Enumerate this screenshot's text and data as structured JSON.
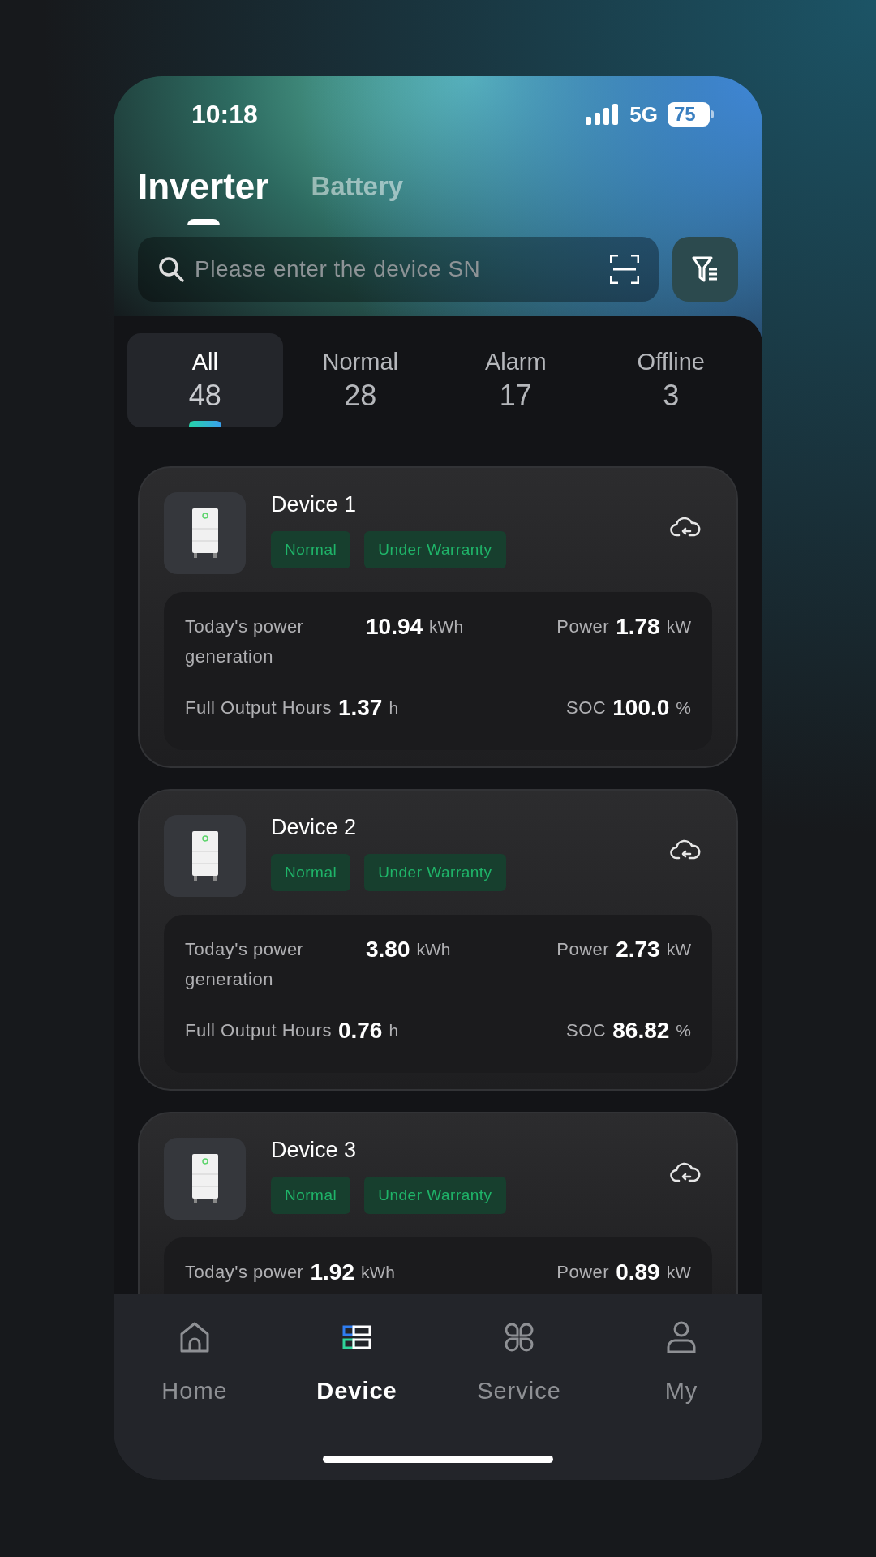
{
  "status_bar": {
    "time": "10:18",
    "network": "5G",
    "battery": "75"
  },
  "tabs": [
    {
      "label": "Inverter",
      "selected": true
    },
    {
      "label": "Battery",
      "selected": false
    }
  ],
  "search": {
    "placeholder": "Please enter the device SN"
  },
  "filters": [
    {
      "label": "All",
      "count": "48",
      "selected": true
    },
    {
      "label": "Normal",
      "count": "28",
      "selected": false
    },
    {
      "label": "Alarm",
      "count": "17",
      "selected": false
    },
    {
      "label": "Offline",
      "count": "3",
      "selected": false
    }
  ],
  "devices": [
    {
      "name": "Device 1",
      "tags": [
        "Normal",
        "Under Warranty"
      ],
      "stats": [
        {
          "label": "Today's power generation",
          "value": "10.94",
          "unit": "kWh"
        },
        {
          "label": "Power",
          "value": "1.78",
          "unit": "kW"
        },
        {
          "label": "Full Output Hours",
          "value": "1.37",
          "unit": "h"
        },
        {
          "label": "SOC",
          "value": "100.0",
          "unit": "%"
        }
      ]
    },
    {
      "name": "Device 2",
      "tags": [
        "Normal",
        "Under Warranty"
      ],
      "stats": [
        {
          "label": "Today's power generation",
          "value": "3.80",
          "unit": "kWh"
        },
        {
          "label": "Power",
          "value": "2.73",
          "unit": "kW"
        },
        {
          "label": "Full Output Hours",
          "value": "0.76",
          "unit": "h"
        },
        {
          "label": "SOC",
          "value": "86.82",
          "unit": "%"
        }
      ]
    },
    {
      "name": "Device 3",
      "tags": [
        "Normal",
        "Under Warranty"
      ],
      "stats": [
        {
          "label": "Today's power",
          "value": "1.92",
          "unit": "kWh"
        },
        {
          "label": "Power",
          "value": "0.89",
          "unit": "kW"
        }
      ]
    }
  ],
  "nav": [
    {
      "label": "Home",
      "selected": false
    },
    {
      "label": "Device",
      "selected": true
    },
    {
      "label": "Service",
      "selected": false
    },
    {
      "label": "My",
      "selected": false
    }
  ]
}
